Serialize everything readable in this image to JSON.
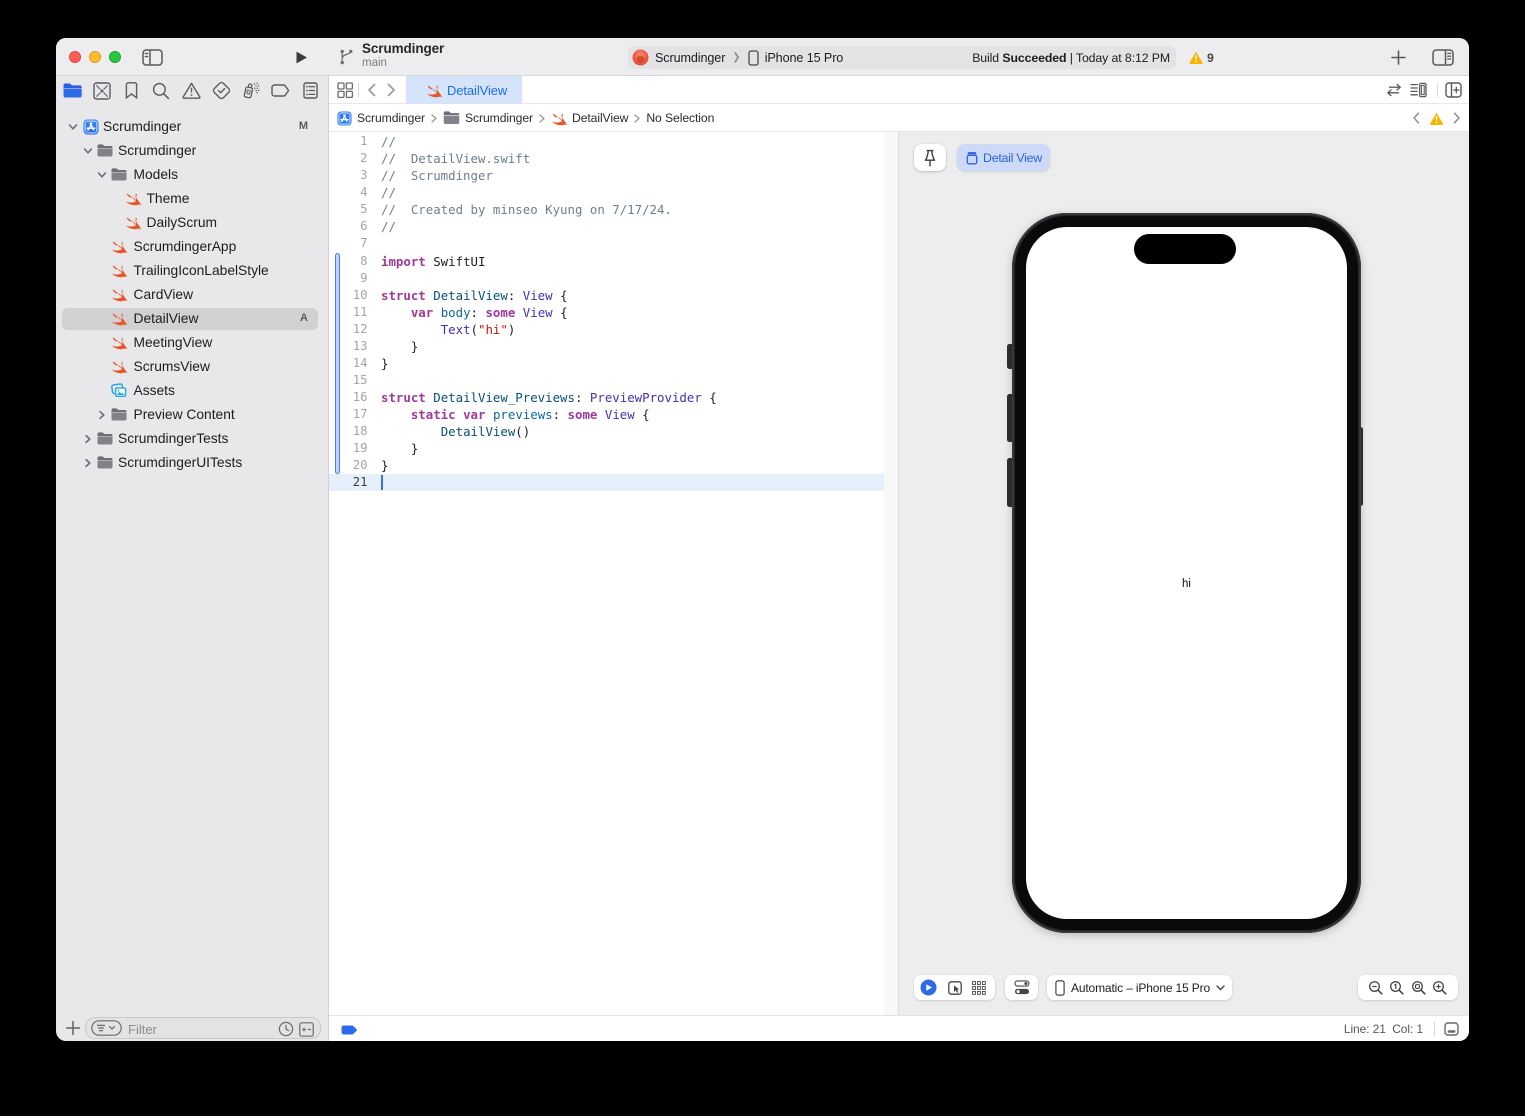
{
  "window": {
    "title": "Scrumdinger",
    "branch": "main"
  },
  "toolbar": {
    "scheme_app": "Scrumdinger",
    "scheme_device": "iPhone 15 Pro",
    "build_label": "Build ",
    "build_result": "Succeeded",
    "build_time": " | Today at 8:12 PM",
    "warning_count": "9"
  },
  "navigator_icons": [
    {
      "name": "project-navigator",
      "icon": "nav-folder",
      "selected": true
    },
    {
      "name": "source-control-navigator",
      "icon": "nav-xsquare",
      "selected": false
    },
    {
      "name": "bookmarks-navigator",
      "icon": "nav-bookmark",
      "selected": false
    },
    {
      "name": "find-navigator",
      "icon": "nav-search",
      "selected": false
    },
    {
      "name": "issues-navigator",
      "icon": "nav-warning",
      "selected": false
    },
    {
      "name": "tests-navigator",
      "icon": "nav-test",
      "selected": false
    },
    {
      "name": "debug-navigator",
      "icon": "nav-spray",
      "selected": false
    },
    {
      "name": "breakpoints-navigator",
      "icon": "nav-breakpoint",
      "selected": false
    },
    {
      "name": "reports-navigator",
      "icon": "nav-report",
      "selected": false
    }
  ],
  "sidebar": {
    "items": [
      {
        "label": "Scrumdinger",
        "level": 0,
        "icon": "project",
        "disclosure": "open",
        "badge": "M"
      },
      {
        "label": "Scrumdinger",
        "level": 1,
        "icon": "folder",
        "disclosure": "open"
      },
      {
        "label": "Models",
        "level": 2,
        "icon": "folder",
        "disclosure": "open"
      },
      {
        "label": "Theme",
        "level": 3,
        "icon": "swift"
      },
      {
        "label": "DailyScrum",
        "level": 3,
        "icon": "swift"
      },
      {
        "label": "ScrumdingerApp",
        "level": 2,
        "icon": "swift"
      },
      {
        "label": "TrailingIconLabelStyle",
        "level": 2,
        "icon": "swift"
      },
      {
        "label": "CardView",
        "level": 2,
        "icon": "swift"
      },
      {
        "label": "DetailView",
        "level": 2,
        "icon": "swift",
        "selected": true,
        "badge": "A"
      },
      {
        "label": "MeetingView",
        "level": 2,
        "icon": "swift"
      },
      {
        "label": "ScrumsView",
        "level": 2,
        "icon": "swift"
      },
      {
        "label": "Assets",
        "level": 2,
        "icon": "assets"
      },
      {
        "label": "Preview Content",
        "level": 2,
        "icon": "folder",
        "disclosure": "closed"
      },
      {
        "label": "ScrumdingerTests",
        "level": 1,
        "icon": "folder",
        "disclosure": "closed"
      },
      {
        "label": "ScrumdingerUITests",
        "level": 1,
        "icon": "folder",
        "disclosure": "closed"
      }
    ],
    "filter_placeholder": "Filter"
  },
  "tabs": {
    "active_label": "DetailView"
  },
  "jumpbar": {
    "segments": [
      {
        "icon": "project",
        "label": "Scrumdinger"
      },
      {
        "icon": "folder",
        "label": "Scrumdinger"
      },
      {
        "icon": "swift",
        "label": "DetailView"
      },
      {
        "icon": null,
        "label": "No Selection"
      }
    ]
  },
  "editor": {
    "current_line": 21,
    "lines": [
      {
        "n": 1,
        "segs": [
          [
            "//",
            "c"
          ]
        ]
      },
      {
        "n": 2,
        "segs": [
          [
            "//  DetailView.swift",
            "c"
          ]
        ]
      },
      {
        "n": 3,
        "segs": [
          [
            "//  Scrumdinger",
            "c"
          ]
        ]
      },
      {
        "n": 4,
        "segs": [
          [
            "//",
            "c"
          ]
        ]
      },
      {
        "n": 5,
        "segs": [
          [
            "//  Created by minseo Kyung on 7/17/24.",
            "c"
          ]
        ]
      },
      {
        "n": 6,
        "segs": [
          [
            "//",
            "c"
          ]
        ]
      },
      {
        "n": 7,
        "segs": []
      },
      {
        "n": 8,
        "segs": [
          [
            "import",
            "k"
          ],
          [
            " SwiftUI",
            "p"
          ]
        ]
      },
      {
        "n": 9,
        "segs": []
      },
      {
        "n": 10,
        "segs": [
          [
            "struct",
            "k"
          ],
          [
            " ",
            "p"
          ],
          [
            "DetailView",
            "td"
          ],
          [
            ": ",
            "p"
          ],
          [
            "View",
            "t"
          ],
          [
            " {",
            "p"
          ]
        ]
      },
      {
        "n": 11,
        "segs": [
          [
            "    ",
            "p"
          ],
          [
            "var",
            "k"
          ],
          [
            " ",
            "p"
          ],
          [
            "body",
            "m"
          ],
          [
            ": ",
            "p"
          ],
          [
            "some",
            "k"
          ],
          [
            " ",
            "p"
          ],
          [
            "View",
            "t"
          ],
          [
            " {",
            "p"
          ]
        ]
      },
      {
        "n": 12,
        "segs": [
          [
            "        ",
            "p"
          ],
          [
            "Text",
            "t"
          ],
          [
            "(",
            "p"
          ],
          [
            "\"hi\"",
            "s"
          ],
          [
            ")",
            "p"
          ]
        ]
      },
      {
        "n": 13,
        "segs": [
          [
            "    }",
            "p"
          ]
        ]
      },
      {
        "n": 14,
        "segs": [
          [
            "}",
            "p"
          ]
        ]
      },
      {
        "n": 15,
        "segs": []
      },
      {
        "n": 16,
        "segs": [
          [
            "struct",
            "k"
          ],
          [
            " ",
            "p"
          ],
          [
            "DetailView_Previews",
            "td"
          ],
          [
            ": ",
            "p"
          ],
          [
            "PreviewProvider",
            "t"
          ],
          [
            " {",
            "p"
          ]
        ]
      },
      {
        "n": 17,
        "segs": [
          [
            "    ",
            "p"
          ],
          [
            "static",
            "k"
          ],
          [
            " ",
            "p"
          ],
          [
            "var",
            "k"
          ],
          [
            " ",
            "p"
          ],
          [
            "previews",
            "m"
          ],
          [
            ": ",
            "p"
          ],
          [
            "some",
            "k"
          ],
          [
            " ",
            "p"
          ],
          [
            "View",
            "t"
          ],
          [
            " {",
            "p"
          ]
        ]
      },
      {
        "n": 18,
        "segs": [
          [
            "        ",
            "p"
          ],
          [
            "DetailView",
            "td"
          ],
          [
            "()",
            "p"
          ]
        ]
      },
      {
        "n": 19,
        "segs": [
          [
            "    }",
            "p"
          ]
        ]
      },
      {
        "n": 20,
        "segs": [
          [
            "}",
            "p"
          ]
        ]
      },
      {
        "n": 21,
        "segs": []
      }
    ],
    "change_bar_lines": [
      8,
      20
    ]
  },
  "canvas": {
    "preview_button_label": "Detail View",
    "device_label": "Automatic – iPhone 15 Pro",
    "phone_text": "hi"
  },
  "statusbar": {
    "line_col": "Line: 21  Col: 1"
  }
}
